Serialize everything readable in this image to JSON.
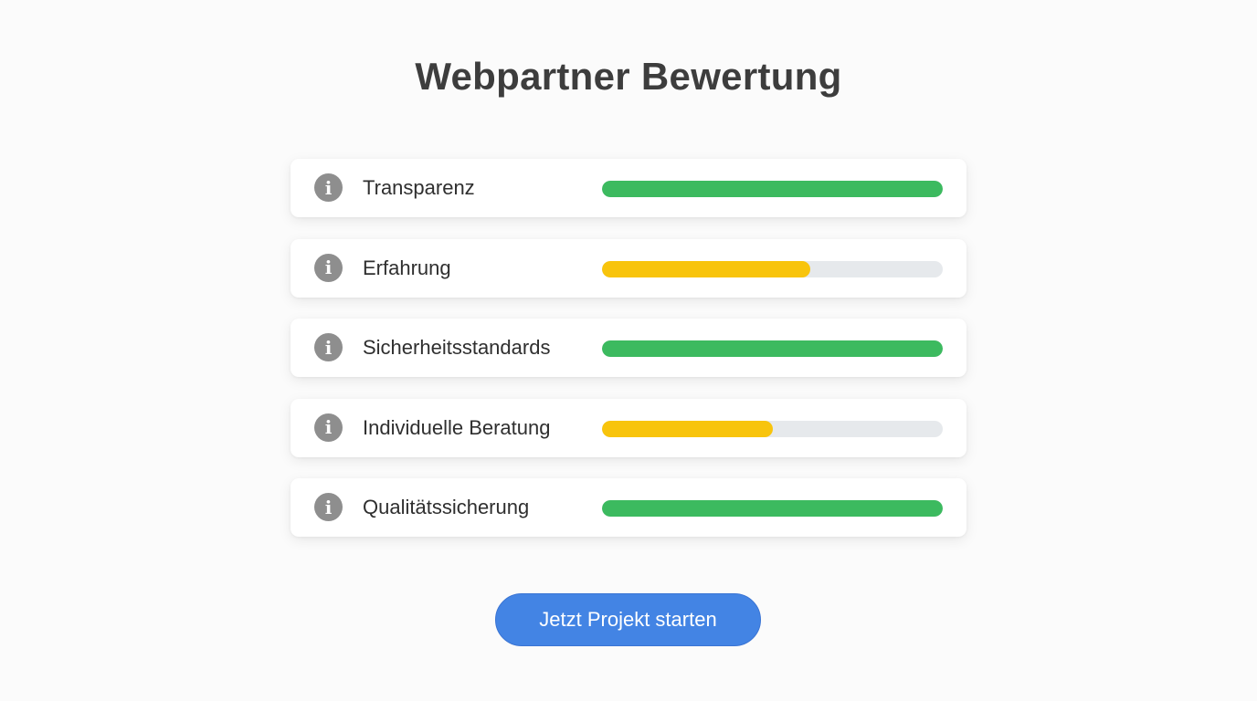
{
  "page": {
    "title": "Webpartner Bewertung"
  },
  "criteria": [
    {
      "label": "Transparenz",
      "info_icon": "info-icon",
      "rating": 1.0,
      "color": "#3cba5f"
    },
    {
      "label": "Erfahrung",
      "info_icon": "info-icon",
      "rating": 0.61,
      "color": "#f8c40c"
    },
    {
      "label": "Sicherheitsstandards",
      "info_icon": "info-icon",
      "rating": 1.0,
      "color": "#3cba5f"
    },
    {
      "label": "Individuelle Beratung",
      "info_icon": "info-icon",
      "rating": 0.5,
      "color": "#f8c40c"
    },
    {
      "label": "Qualitätssicherung",
      "info_icon": "info-icon",
      "rating": 1.0,
      "color": "#3cba5f"
    }
  ],
  "colors": {
    "good": "#3cba5f",
    "medium": "#f8c40c",
    "track": "#e6e9ec",
    "button": "#4384e4"
  },
  "cta": {
    "label": "Jetzt Projekt starten"
  }
}
